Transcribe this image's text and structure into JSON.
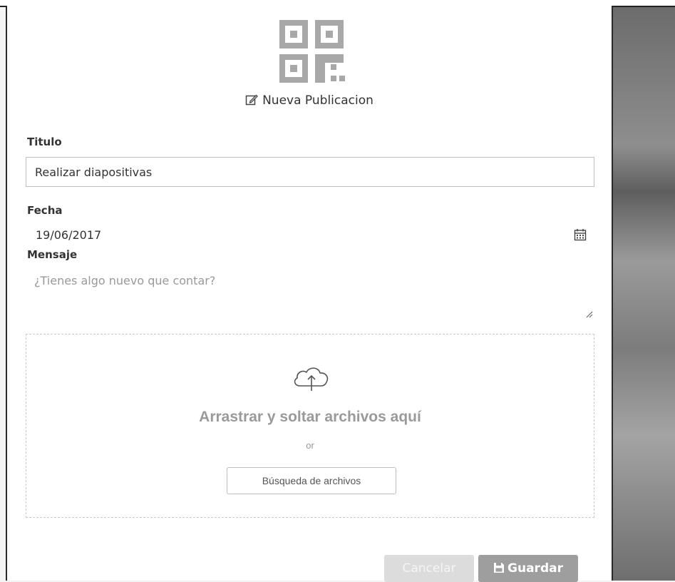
{
  "dialog": {
    "title": "Nueva Publicacion",
    "header_icon": "edit-icon",
    "logo_icon": "qr-code-logo"
  },
  "form": {
    "titulo": {
      "label": "Titulo",
      "value": "Realizar diapositivas"
    },
    "fecha": {
      "label": "Fecha",
      "value": "19/06/2017",
      "icon": "calendar-icon"
    },
    "mensaje": {
      "label": "Mensaje",
      "placeholder": "¿Tienes algo nuevo que contar?"
    }
  },
  "dropzone": {
    "icon": "cloud-upload-icon",
    "title": "Arrastrar y soltar archivos aquí",
    "or_text": "or",
    "browse_label": "Búsqueda de archivos"
  },
  "actions": {
    "cancel_label": "Cancelar",
    "save_label": "Guardar",
    "save_icon": "save-icon"
  },
  "colors": {
    "logo_gray": "#a8a8a8",
    "save_button": "#9e9e9e",
    "cancel_button": "#dcdcdc"
  }
}
